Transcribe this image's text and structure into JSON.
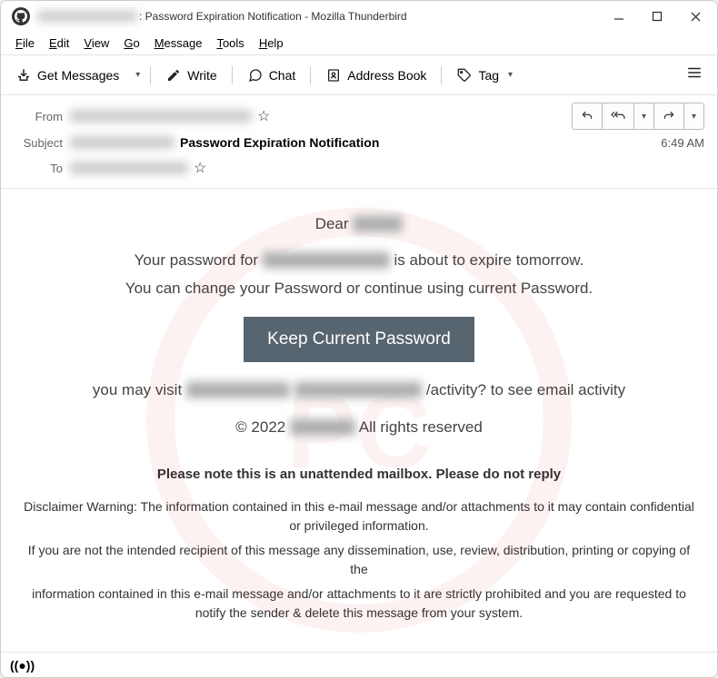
{
  "titlebar": {
    "title_suffix": ": Password Expiration Notification - Mozilla Thunderbird"
  },
  "menubar": [
    {
      "label": "File",
      "ul": 0
    },
    {
      "label": "Edit",
      "ul": 0
    },
    {
      "label": "View",
      "ul": 0
    },
    {
      "label": "Go",
      "ul": 0
    },
    {
      "label": "Message",
      "ul": 0
    },
    {
      "label": "Tools",
      "ul": 0
    },
    {
      "label": "Help",
      "ul": 0
    }
  ],
  "toolbar": {
    "get_messages": "Get Messages",
    "write": "Write",
    "chat": "Chat",
    "address_book": "Address Book",
    "tag": "Tag"
  },
  "headers": {
    "from_label": "From",
    "subject_label": "Subject",
    "to_label": "To",
    "subject_bold": "Password Expiration Notification",
    "time": "6:49 AM"
  },
  "body": {
    "greeting": "Dear",
    "line1a": "Your password for",
    "line1b": "is about to expire tomorrow.",
    "line2": "You can change your Password  or continue using current Password.",
    "cta": "Keep Current Password",
    "visit_a": "you may visit",
    "visit_b": "/activity? to see email activity",
    "copyright_a": "© 2022",
    "copyright_b": "All rights reserved",
    "please_note": "Please note this is an  unattended mailbox. Please do not reply",
    "disclaimer1": "Disclaimer Warning: The information contained in this e-mail message and/or attachments to it may contain confidential or privileged information.",
    "disclaimer2": "If you are not the intended recipient of this message any dissemination, use, review, distribution, printing or copying of the",
    "disclaimer3": "information contained in this e-mail message and/or attachments to it are strictly prohibited and you are requested to notify the sender & delete this message from your system."
  }
}
